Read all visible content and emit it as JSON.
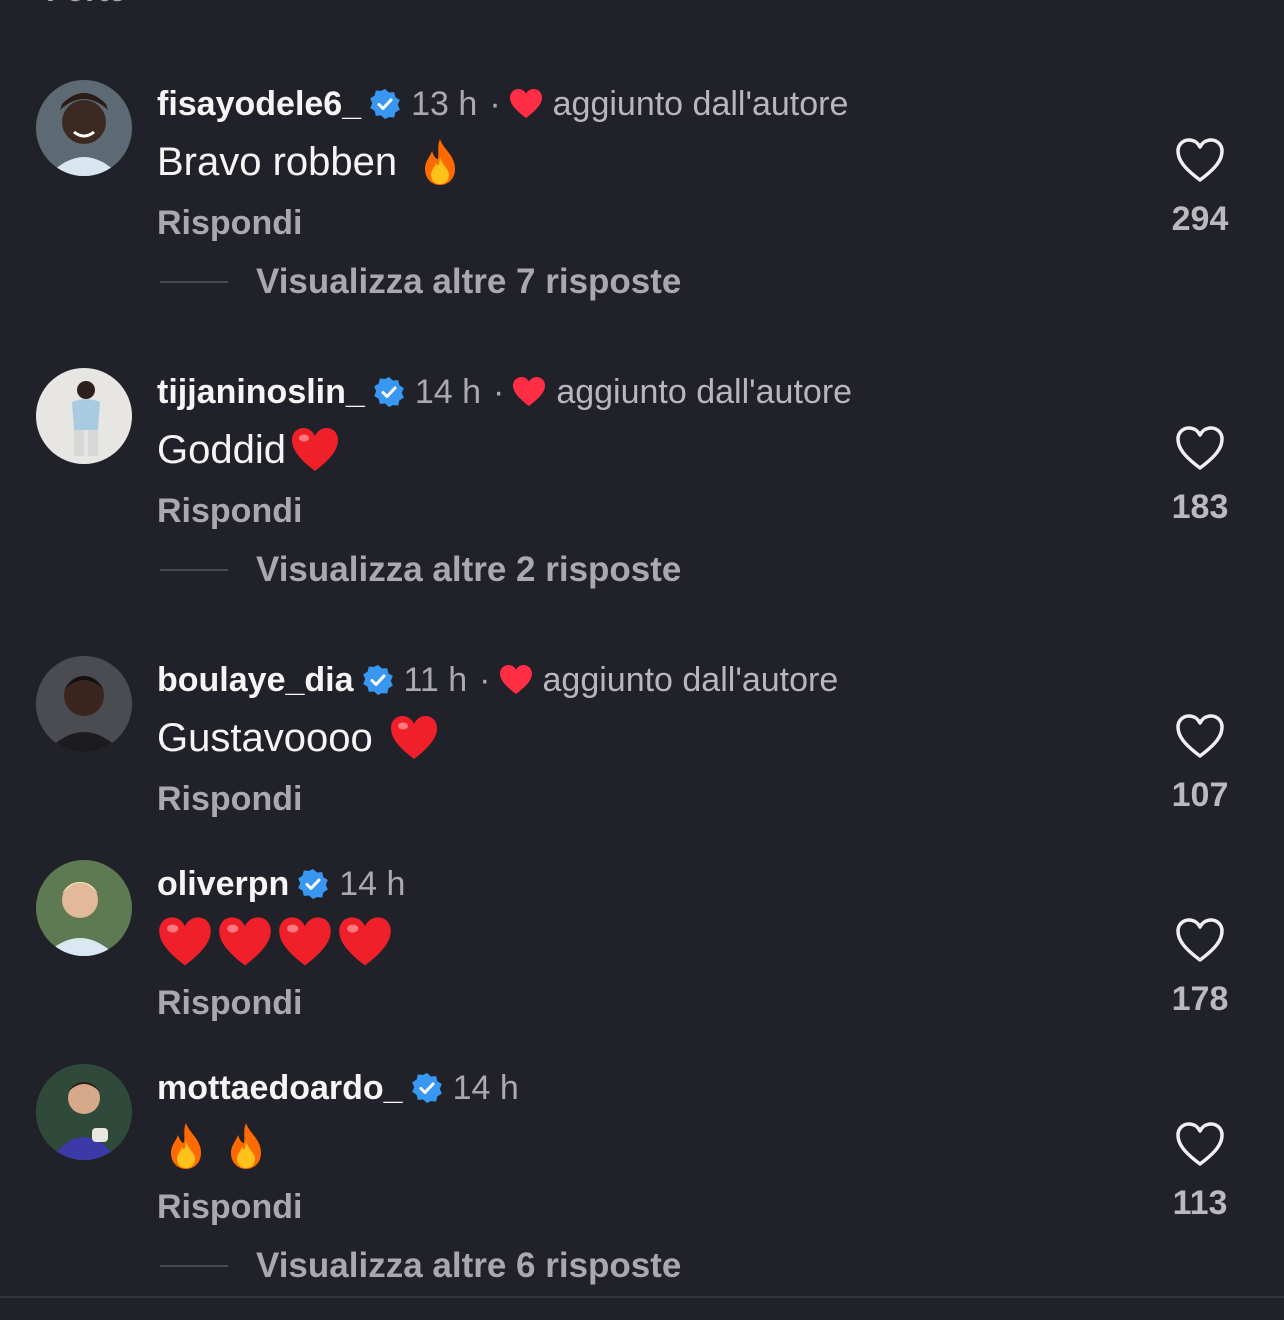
{
  "top_partial_text": "Forte",
  "reply_label": "Rispondi",
  "comments": [
    {
      "username": "fisayodele6_",
      "verified": true,
      "time": "13 h",
      "dot": "·",
      "author_liked": "aggiunto dall'autore",
      "text": "Bravo robben",
      "emojis": [
        "fire-emoji"
      ],
      "likes": "294",
      "more_replies": "Visualizza altre 7 risposte"
    },
    {
      "username": "tijjaninoslin_",
      "verified": true,
      "time": "14 h",
      "dot": "·",
      "author_liked": "aggiunto dall'autore",
      "text": "Goddid",
      "emojis": [
        "red-heart-emoji"
      ],
      "likes": "183",
      "more_replies": "Visualizza altre 2 risposte"
    },
    {
      "username": "boulaye_dia",
      "verified": true,
      "time": "11 h",
      "dot": "·",
      "author_liked": "aggiunto dall'autore",
      "text": "Gustavoooo",
      "emojis": [
        "red-heart-emoji"
      ],
      "likes": "107",
      "more_replies": ""
    },
    {
      "username": "oliverpn",
      "verified": true,
      "time": "14 h",
      "dot": "",
      "author_liked": "",
      "text": "",
      "emojis": [
        "red-heart-emoji",
        "red-heart-emoji",
        "red-heart-emoji",
        "red-heart-emoji"
      ],
      "likes": "178",
      "more_replies": ""
    },
    {
      "username": "mottaedoardo_",
      "verified": true,
      "time": "14 h",
      "dot": "",
      "author_liked": "",
      "text": "",
      "emojis": [
        "fire-emoji",
        "fire-emoji"
      ],
      "likes": "113",
      "more_replies": "Visualizza altre 6 risposte"
    }
  ],
  "colors": {
    "background": "#212129",
    "verified_badge": "#3897f0",
    "author_heart": "#ff2e45",
    "muted_text": "#a8a8ae"
  }
}
